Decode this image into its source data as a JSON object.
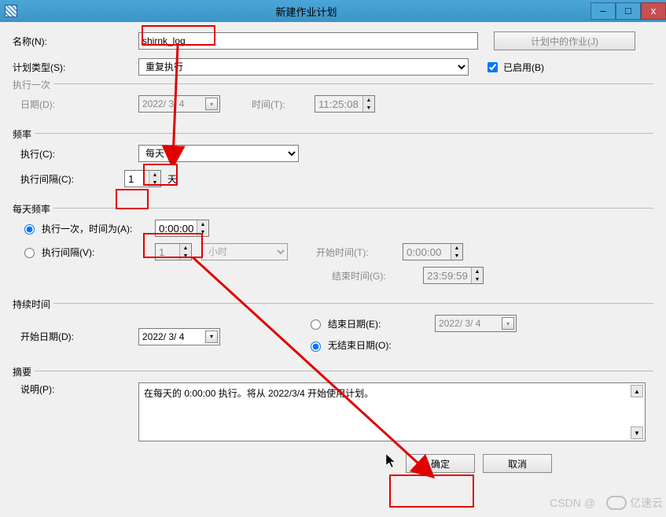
{
  "window": {
    "title": "新建作业计划",
    "minimize": "–",
    "maximize": "□",
    "close": "x"
  },
  "header": {
    "name_label": "名称(N):",
    "name_value": "shirnk_log",
    "type_label": "计划类型(S):",
    "type_value": "重复执行",
    "plan_jobs_btn": "计划中的作业(J)",
    "enabled_label": "已启用(B)"
  },
  "once": {
    "legend": "执行一次",
    "date_label": "日期(D):",
    "date_value": "2022/ 3/ 4",
    "time_label": "时间(T):",
    "time_value": "11:25:08"
  },
  "freq": {
    "legend": "频率",
    "exec_label": "执行(C):",
    "exec_value": "每天",
    "interval_label": "执行间隔(C):",
    "interval_value": "1",
    "interval_unit": "天"
  },
  "daily": {
    "legend": "每天频率",
    "once_radio": "执行一次，时间为(A):",
    "once_time": "0:00:00",
    "interval_radio": "执行间隔(V):",
    "interval_value": "1",
    "interval_unit": "小时",
    "start_time_label": "开始时间(T):",
    "start_time_value": "0:00:00",
    "end_time_label": "结束时间(G):",
    "end_time_value": "23:59:59"
  },
  "duration": {
    "legend": "持续时间",
    "start_date_label": "开始日期(D):",
    "start_date_value": "2022/ 3/ 4",
    "end_date_radio": "结束日期(E):",
    "end_date_value": "2022/ 3/ 4",
    "no_end_radio": "无结束日期(O):"
  },
  "summary": {
    "legend": "摘要",
    "desc_label": "说明(P):",
    "desc_value": "在每天的 0:00:00 执行。将从 2022/3/4 开始使用计划。"
  },
  "footer": {
    "ok": "确定",
    "cancel": "取消"
  },
  "watermark": {
    "csdn": "CSDN @",
    "brand": "亿速云"
  }
}
